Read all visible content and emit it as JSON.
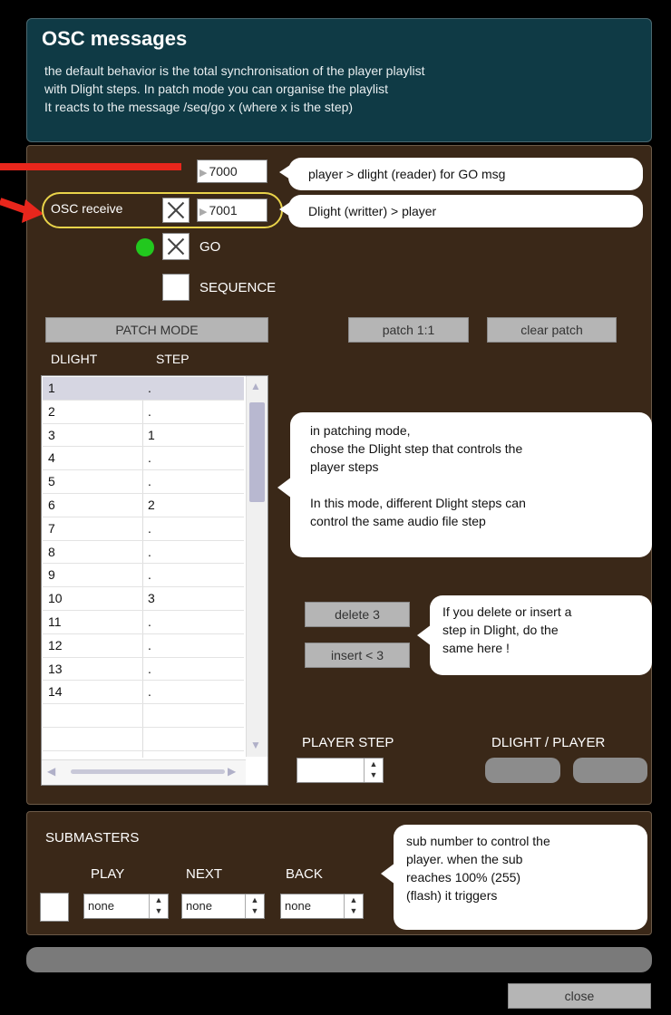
{
  "header": {
    "title": "OSC messages",
    "lines": [
      "the default behavior is the total synchronisation of the player playlist",
      "with Dlight steps. In patch mode you can organise the playlist",
      "It reacts to the message  /seq/go x (where x is the step)"
    ]
  },
  "osc": {
    "send_port": "7000",
    "send_desc": "player > dlight (reader) for GO msg",
    "receive_label": "OSC receive",
    "receive_port": "7001",
    "receive_desc": "Dlight (writter) > player",
    "go_label": "GO",
    "sequence_label": "SEQUENCE"
  },
  "patch": {
    "mode_button": "PATCH MODE",
    "patch11_button": "patch 1:1",
    "clear_button": "clear patch",
    "col_dlight": "DLIGHT",
    "col_step": "STEP",
    "rows": [
      {
        "dlight": "1",
        "step": "."
      },
      {
        "dlight": "2",
        "step": "."
      },
      {
        "dlight": "3",
        "step": "1"
      },
      {
        "dlight": "4",
        "step": "."
      },
      {
        "dlight": "5",
        "step": "."
      },
      {
        "dlight": "6",
        "step": "2"
      },
      {
        "dlight": "7",
        "step": "."
      },
      {
        "dlight": "8",
        "step": "."
      },
      {
        "dlight": "9",
        "step": "."
      },
      {
        "dlight": "10",
        "step": "3"
      },
      {
        "dlight": "11",
        "step": "."
      },
      {
        "dlight": "12",
        "step": "."
      },
      {
        "dlight": "13",
        "step": "."
      },
      {
        "dlight": "14",
        "step": "."
      },
      {
        "dlight": "",
        "step": ""
      },
      {
        "dlight": "",
        "step": ""
      },
      {
        "dlight": "",
        "step": ""
      }
    ],
    "patching_help": [
      "in patching mode,",
      "chose the Dlight step that controls the",
      "player steps",
      "",
      "In this mode, different Dlight steps can",
      "control the same audio file step"
    ],
    "delete_button": "delete 3",
    "insert_button": "insert < 3",
    "delete_help": [
      "If you delete or insert a",
      "step in Dlight, do the",
      "same here !"
    ],
    "player_step_label": "PLAYER STEP",
    "dlight_player_label": "DLIGHT / PLAYER"
  },
  "submasters": {
    "title": "SUBMASTERS",
    "play_label": "PLAY",
    "next_label": "NEXT",
    "back_label": "BACK",
    "play_value": "none",
    "next_value": "none",
    "back_value": "none",
    "help": [
      "sub number to control the",
      "player. when the sub",
      "reaches 100% (255)",
      "(flash) it triggers"
    ]
  },
  "footer": {
    "close_button": "close"
  },
  "colors": {
    "header_bg": "#0f3a45",
    "panel_bg": "#3a2818",
    "arrow_red": "#e8261c",
    "go_indicator": "#22c81e",
    "highlight_outline": "#e9d34a"
  }
}
